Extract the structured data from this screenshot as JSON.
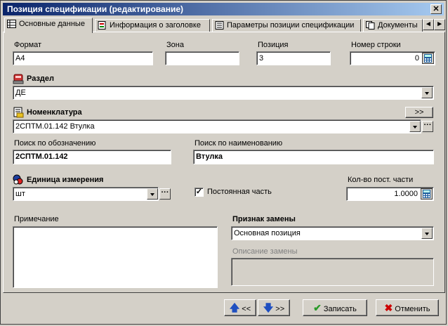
{
  "window": {
    "title": "Позиция спецификации (редактирование)"
  },
  "tabs": [
    {
      "label": "Основные данные"
    },
    {
      "label": "Информация о заголовке"
    },
    {
      "label": "Параметры позиции спецификации"
    },
    {
      "label": "Документы"
    }
  ],
  "fields": {
    "format": {
      "label": "Формат",
      "value": "А4"
    },
    "zone": {
      "label": "Зона",
      "value": ""
    },
    "position": {
      "label": "Позиция",
      "value": "3"
    },
    "line_number": {
      "label": "Номер строки",
      "value": "0"
    },
    "section": {
      "label": "Раздел",
      "value": "ДЕ"
    },
    "nomenclature": {
      "label": "Номенклатура",
      "value": "2СПТМ.01.142  Втулка",
      "expand_label": ">>"
    },
    "search_designation": {
      "label": "Поиск по обозначению",
      "value": "2СПТМ.01.142"
    },
    "search_name": {
      "label": "Поиск по наименованию",
      "value": "Втулка"
    },
    "unit": {
      "label": "Единица измерения",
      "value": "шт"
    },
    "constant_part": {
      "label": "Постоянная часть",
      "checked": true
    },
    "const_qty": {
      "label": "Кол-во пост. части",
      "value": "1.0000"
    },
    "note": {
      "label": "Примечание",
      "value": ""
    },
    "replacement": {
      "label": "Признак замены",
      "value": "Основная позиция"
    },
    "replacement_desc": {
      "label": "Описание замены",
      "value": ""
    }
  },
  "buttons": {
    "prev": "<<",
    "next": ">>",
    "save": "Записать",
    "cancel": "Отменить"
  }
}
